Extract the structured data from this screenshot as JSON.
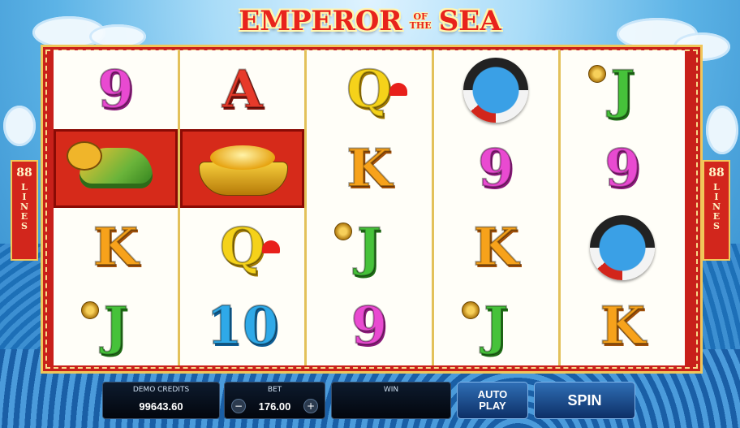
{
  "game": {
    "title_main_left": "EMPEROR",
    "title_of": "OF",
    "title_the": "THE",
    "title_main_right": "SEA"
  },
  "side_badges": {
    "left": {
      "number": "88",
      "label": "LINES"
    },
    "right": {
      "number": "88",
      "label": "LINES"
    }
  },
  "reels": [
    [
      "9",
      "dragon",
      "K",
      "J"
    ],
    [
      "A",
      "gold-ingot",
      "Q",
      "10"
    ],
    [
      "Q",
      "K",
      "J",
      "9"
    ],
    [
      "koi",
      "9",
      "K",
      "J"
    ],
    [
      "J",
      "9",
      "koi",
      "K"
    ]
  ],
  "highlighted_cells": [
    "0-1",
    "1-1"
  ],
  "controls": {
    "credits_label": "DEMO CREDITS",
    "credits_value": "99643.60",
    "bet_label": "BET",
    "bet_value": "176.00",
    "bet_minus": "−",
    "bet_plus": "+",
    "win_label": "WIN",
    "win_value": "",
    "autoplay_line1": "AUTO",
    "autoplay_line2": "PLAY",
    "spin_label": "SPIN"
  },
  "colors": {
    "frame": "#c8201a",
    "frame_trim": "#f0c65a",
    "button": "#2f6fb6"
  }
}
